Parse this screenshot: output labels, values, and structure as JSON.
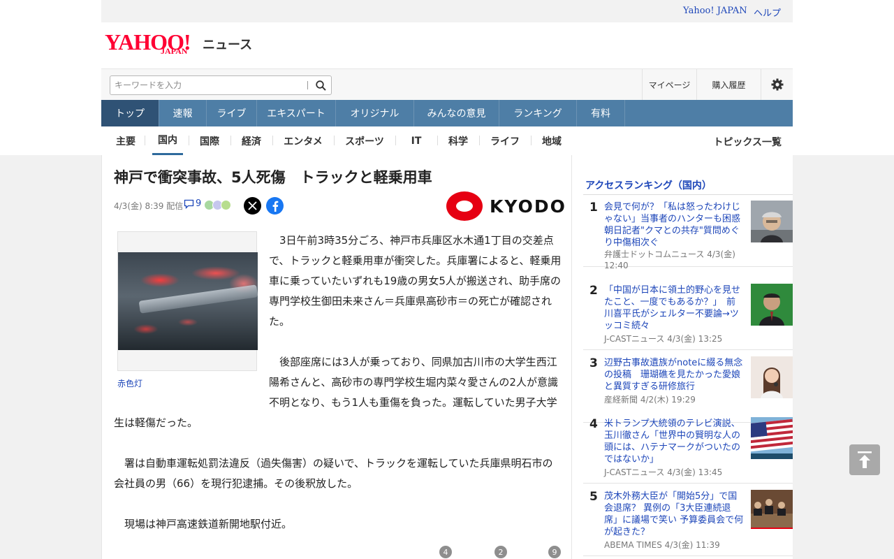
{
  "util": {
    "yahoo_japan": "Yahoo! JAPAN",
    "help": "ヘルプ"
  },
  "logo": {
    "yahoo": "YAHOO!",
    "japan": "JAPAN",
    "news": "ニュース"
  },
  "search": {
    "placeholder": "キーワードを入力"
  },
  "tools": {
    "mypage": "マイページ",
    "history": "購入履歴"
  },
  "main_nav": [
    "トップ",
    "速報",
    "ライブ",
    "エキスパート",
    "オリジナル",
    "みんなの意見",
    "ランキング",
    "有料"
  ],
  "sub_nav": [
    "主要",
    "国内",
    "国際",
    "経済",
    "エンタメ",
    "スポーツ",
    "IT",
    "科学",
    "ライフ",
    "地域"
  ],
  "sub_nav_more": "トピックス一覧",
  "article": {
    "title": "神戸で衝突事故、5人死傷　トラックと軽乗用車",
    "date": "4/3(金) 8:39 配信",
    "comment_count": "9",
    "source_logo": "KYODO",
    "photo_caption": "赤色灯",
    "paragraphs": [
      "　3日午前3時35分ごろ、神戸市兵庫区水木通1丁目の交差点で、トラックと軽乗用車が衝突した。兵庫署によると、軽乗用車に乗っていたいずれも19歳の男女5人が搬送され、助手席の専門学校生御田未来さん＝兵庫県高砂市＝の死亡が確認された。",
      "　後部座席には3人が乗っており、同県加古川市の大学生西江陽希さんと、高砂市の専門学校生堀内菜々愛さんの2人が意識不明となり、もう1人も重傷を負った。運転していた男子大学生は軽傷だった。",
      "　署は自動車運転処罰法違反（過失傷害）の疑いで、トラックを運転していた兵庫県明石市の会社員の男（66）を現行犯逮捕。その後釈放した。",
      "　現場は神戸高速鉄道新開地駅付近。"
    ],
    "reaction_counts": [
      "4",
      "2",
      "9"
    ]
  },
  "ranking": {
    "heading": "アクセスランキング（国内）",
    "items": [
      {
        "rank": "1",
        "title": "会見で何が？「私は怒ったわけじゃない」当事者のハンターも困惑 朝日記者\"クマとの共存\"質問めぐり中傷相次ぐ",
        "source": "弁護士ドットコムニュース 4/3(金) 12:40"
      },
      {
        "rank": "2",
        "title": "「中国が日本に領土的野心を見せたこと、一度でもあるか？」　前川喜平氏がシェルター不要論→ツッコミ続々",
        "source": "J-CASTニュース 4/3(金) 13:25"
      },
      {
        "rank": "3",
        "title": "辺野古事故遺族がnoteに綴る無念の投稿　珊瑚礁を見たかった愛娘と異質すぎる研修旅行",
        "source": "産経新聞 4/2(木) 19:29"
      },
      {
        "rank": "4",
        "title": "米トランプ大統領のテレビ演説、玉川徹さん「世界中の賢明な人の頭には、ハテナマークがついたのではないか」",
        "source": "J-CASTニュース 4/3(金) 13:45"
      },
      {
        "rank": "5",
        "title": "茂木外務大臣が「開始5分」で国会退席？ 異例の「3大臣連続退席」に議場で笑い 予算委員会で何が起きた？",
        "source": "ABEMA TIMES 4/3(金) 11:39"
      }
    ]
  },
  "colors": {
    "nav_bg": "#4e7ea6",
    "nav_active": "#2f5275",
    "link": "#1d46b9",
    "kyodo_red": "#e60012",
    "yahoo_red": "#ff0033"
  }
}
